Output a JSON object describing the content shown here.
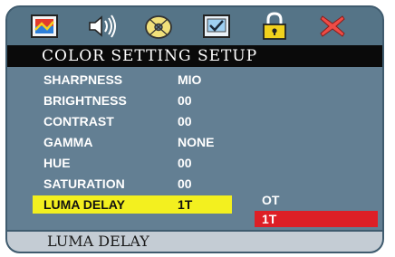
{
  "header": {
    "title": "COLOR SETTING SETUP",
    "icons": [
      {
        "name": "picture-icon"
      },
      {
        "name": "audio-speaker-icon"
      },
      {
        "name": "disc-icon"
      },
      {
        "name": "checkbox-preferences-icon"
      },
      {
        "name": "lock-icon"
      },
      {
        "name": "exit-x-icon"
      }
    ]
  },
  "settings": [
    {
      "label": "SHARPNESS",
      "value": "MIO"
    },
    {
      "label": "BRIGHTNESS",
      "value": "00"
    },
    {
      "label": "CONTRAST",
      "value": "00"
    },
    {
      "label": "GAMMA",
      "value": "NONE"
    },
    {
      "label": "HUE",
      "value": "00"
    },
    {
      "label": "SATURATION",
      "value": "00"
    },
    {
      "label": "LUMA DELAY",
      "value": "1T",
      "selected": true
    }
  ],
  "options": [
    {
      "label": "OT"
    },
    {
      "label": "1T",
      "selected": true
    }
  ],
  "status_text": "LUMA DELAY",
  "colors": {
    "panel": "#637f93",
    "title_bar": "#0a0a0a",
    "selection_yellow": "#f3f01f",
    "selection_red": "#dd1f26",
    "status_bar": "#c4ccd4"
  }
}
